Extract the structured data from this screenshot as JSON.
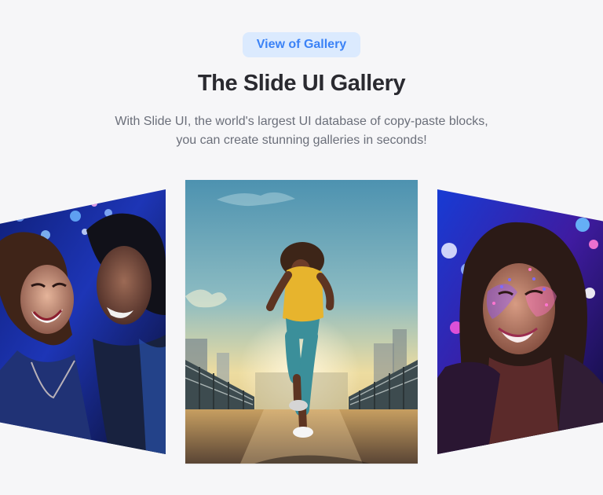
{
  "header": {
    "badge_label": "View of Gallery",
    "title": "The Slide UI Gallery",
    "description_line_1": "With Slide UI, the world's largest UI database of copy-paste blocks,",
    "description_line_2": "you can create stunning galleries in seconds!"
  },
  "gallery": {
    "images": [
      {
        "id": "left",
        "subject": "Laughing woman and man at a nightlife party",
        "accent": "#1b4bff"
      },
      {
        "id": "center",
        "subject": "Runner in yellow tank top on a bridge at sunset",
        "accent": "#f6d57a"
      },
      {
        "id": "right",
        "subject": "Smiling woman with neon glitter face paint",
        "accent": "#7b5cff"
      }
    ]
  },
  "colors": {
    "background": "#f6f6f8",
    "badge_bg": "#dbeafe",
    "badge_text": "#3b82f6",
    "title_text": "#2a2a30",
    "body_text": "#6b6f7a"
  }
}
